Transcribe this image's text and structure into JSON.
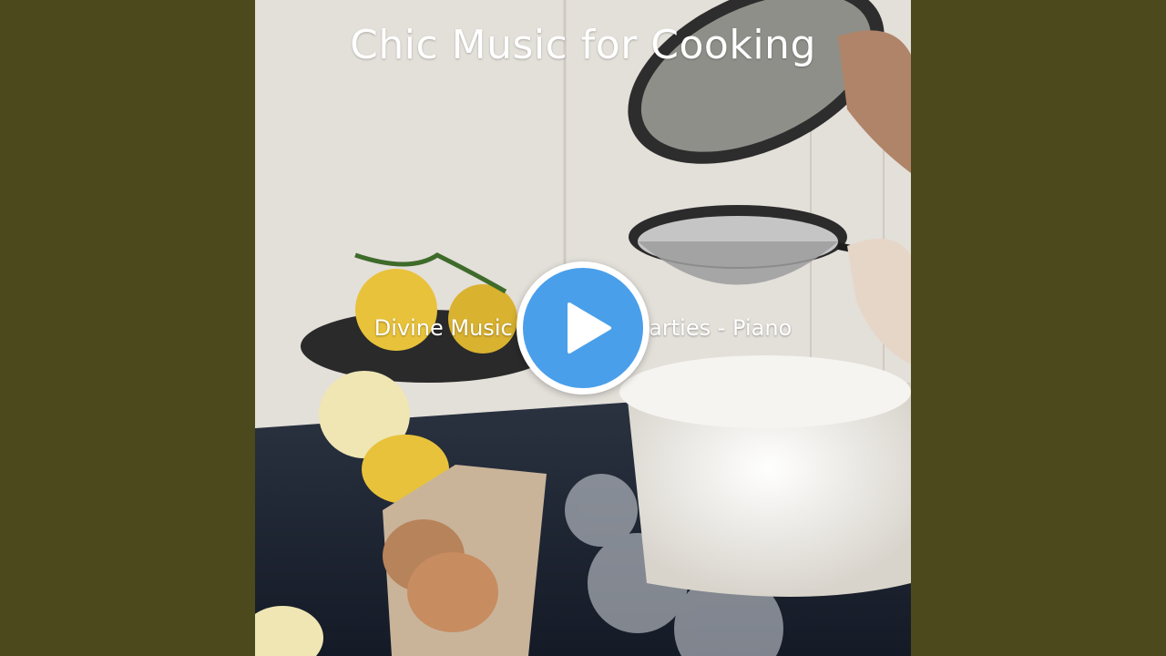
{
  "player": {
    "title": "Chic Music for Cooking",
    "subtitle": "Divine Music for Dinner Parties - Piano",
    "play_icon": "play-icon"
  },
  "colors": {
    "background": "#4c4a1d",
    "play_accent": "#4a9fea",
    "text": "#ffffff"
  }
}
